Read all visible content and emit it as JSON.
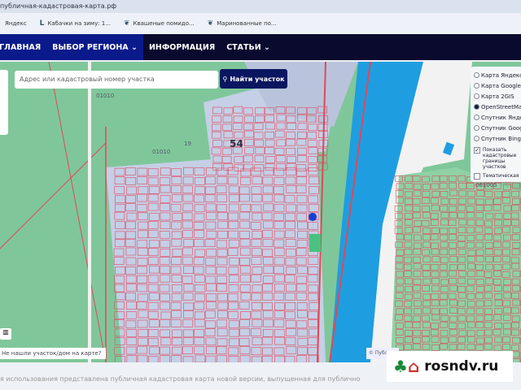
{
  "browser": {
    "title": "публичная-кадастровая-карта.рф",
    "bookmarks": [
      {
        "icon": "yandex-icon",
        "glyph": "",
        "label": "Яндекс"
      },
      {
        "icon": "L-icon",
        "glyph": "L",
        "label": "Кабачки на зиму: 1..."
      },
      {
        "icon": "leaf-icon",
        "glyph": "❦",
        "label": "Квашеные помидо..."
      },
      {
        "icon": "leaf-icon",
        "glyph": "❦",
        "label": "Маринованные по..."
      }
    ]
  },
  "nav": {
    "items": [
      "ГЛАВНАЯ",
      "ВЫБОР РЕГИОНА ⌄",
      "ИНФОРМАЦИЯ",
      "СТАТЬИ ⌄"
    ]
  },
  "search": {
    "placeholder": "Адрес или кадастровый номер участка",
    "button": "Найти участок"
  },
  "layers": {
    "items": [
      {
        "label": "Карта Яндекс",
        "selected": false
      },
      {
        "label": "Карта Google",
        "selected": false
      },
      {
        "label": "Карта 2GIS",
        "selected": false
      },
      {
        "label": "OpenStreetMap",
        "selected": true
      },
      {
        "label": "Спутник Яндекс",
        "selected": false
      },
      {
        "label": "Спутник Google",
        "selected": false
      },
      {
        "label": "Спутник Bing",
        "selected": false
      }
    ],
    "show_borders": {
      "label": "Показать кадастровые границы участков",
      "checked": true
    },
    "thematic": {
      "label": "Тематическая",
      "checked": false
    }
  },
  "map": {
    "labels": [
      "01010",
      "54",
      "19",
      "01010",
      "061005"
    ],
    "marker_color": "#1a3fd0",
    "water_color": "#1e9ee0",
    "parcel_color": "#e0485a"
  },
  "not_found": "Не нашли участок/дом на карте?",
  "attribution": "© Публ",
  "footer": "я использования представлена публичная кадастровая карта новой версии, выпущенная для публично",
  "watermark": "rosndv.ru"
}
